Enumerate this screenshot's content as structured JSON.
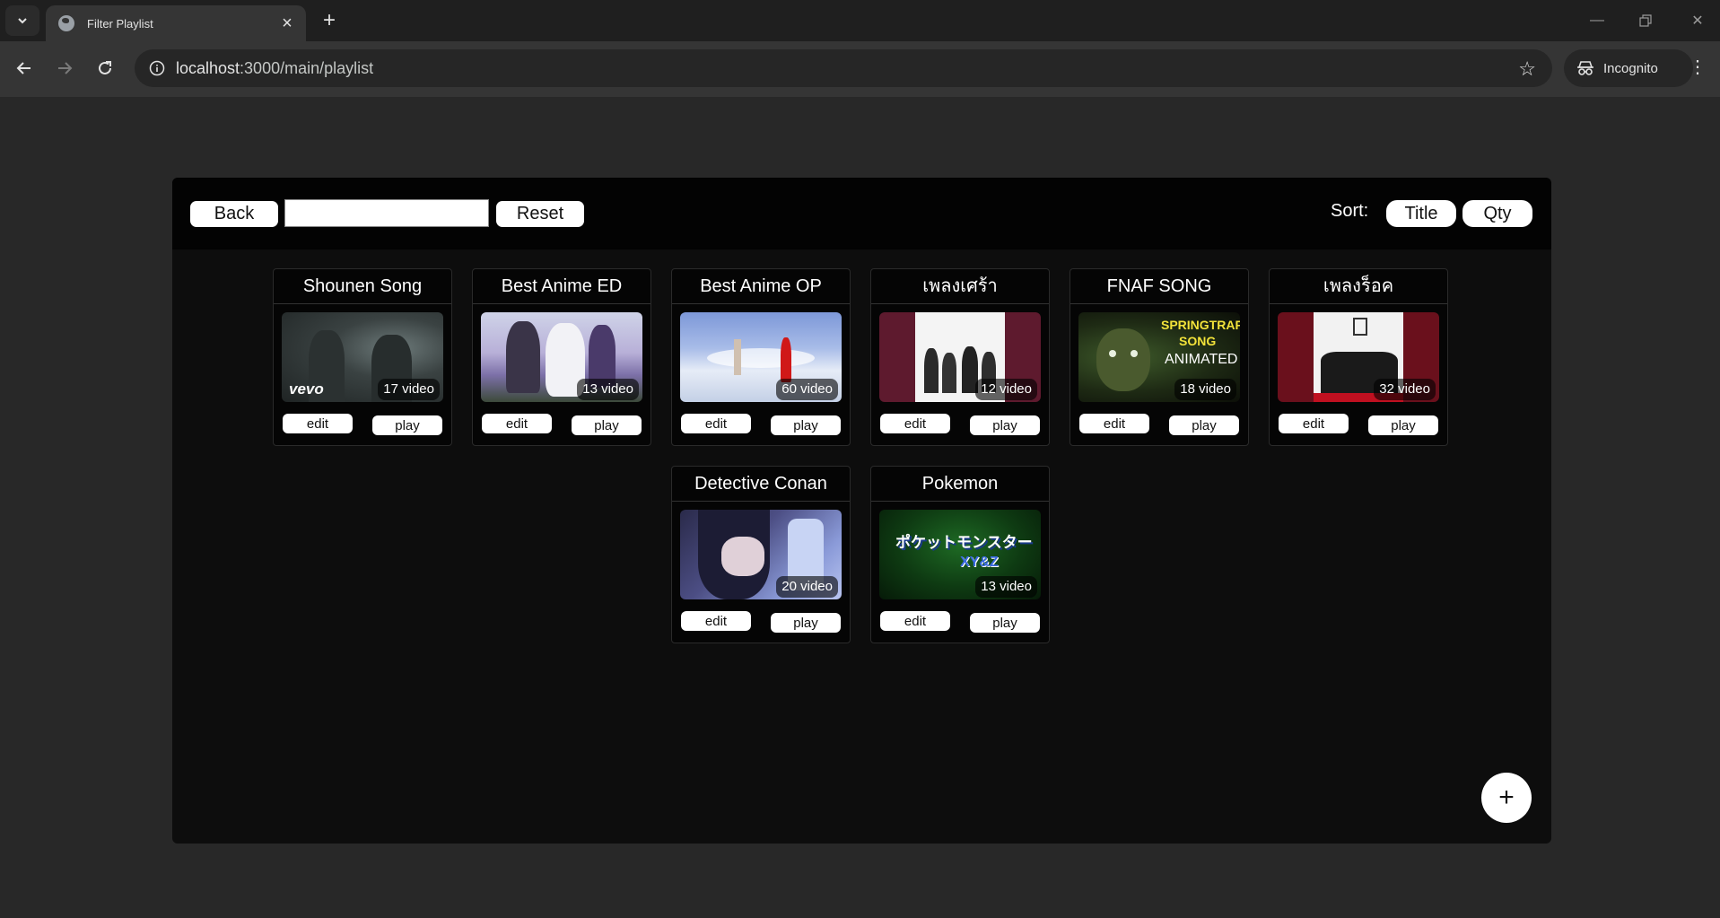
{
  "browser": {
    "tab_title": "Filter Playlist",
    "url_host": "localhost",
    "url_path": ":3000/main/playlist",
    "profile_label": "Incognito"
  },
  "toolbar": {
    "back_label": "Back",
    "search_value": "",
    "reset_label": "Reset",
    "sort_label": "Sort:",
    "sort_title_label": "Title",
    "sort_qty_label": "Qty"
  },
  "playlists": [
    {
      "title": "Shounen Song",
      "count": "17 video",
      "edit_label": "edit",
      "play_label": "play",
      "thumb_text": "vevo"
    },
    {
      "title": "Best Anime ED",
      "count": "13 video",
      "edit_label": "edit",
      "play_label": "play"
    },
    {
      "title": "Best Anime OP",
      "count": "60 video",
      "edit_label": "edit",
      "play_label": "play"
    },
    {
      "title": "เพลงเศร้า",
      "count": "12 video",
      "edit_label": "edit",
      "play_label": "play"
    },
    {
      "title": "FNAF SONG",
      "count": "18 video",
      "edit_label": "edit",
      "play_label": "play",
      "thumb_text": [
        "SPRINGTRAP",
        "SONG",
        "ANIMATED"
      ]
    },
    {
      "title": "เพลงร็อค",
      "count": "32 video",
      "edit_label": "edit",
      "play_label": "play"
    },
    {
      "title": "Detective Conan",
      "count": "20 video",
      "edit_label": "edit",
      "play_label": "play"
    },
    {
      "title": "Pokemon",
      "count": "13 video",
      "edit_label": "edit",
      "play_label": "play",
      "thumb_text": [
        "ポケットモンスター",
        "XY&Z"
      ]
    }
  ],
  "add_button_label": "+",
  "colors": {
    "page_bg": "#282828",
    "panel_bg": "#0d0d0d",
    "header_bg": "#030303",
    "button_bg": "#ffffff"
  }
}
